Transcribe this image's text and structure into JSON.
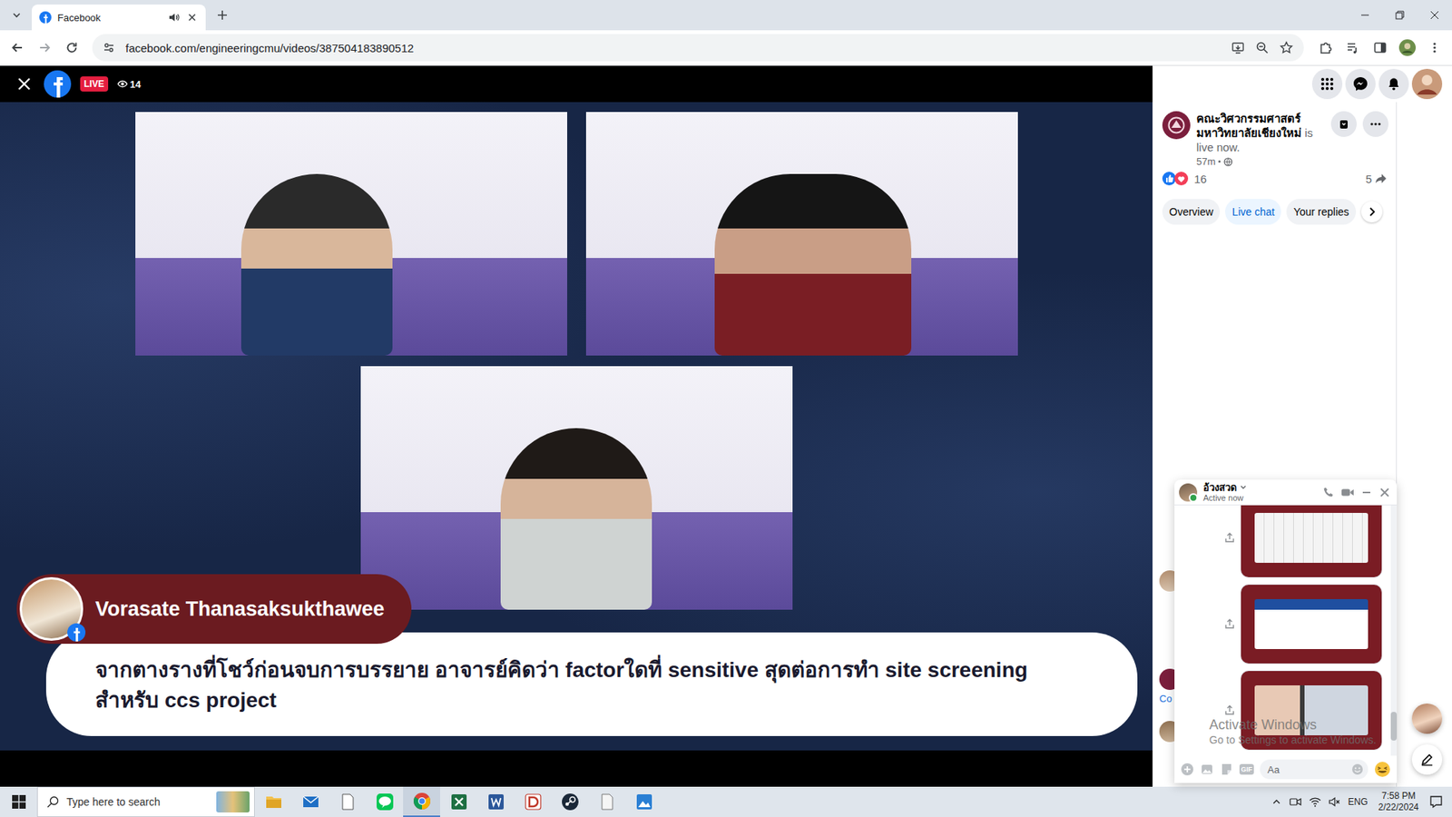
{
  "browser": {
    "tabs": [
      {
        "label": "Facebook",
        "selected": true,
        "audio_playing": true
      }
    ],
    "url": "facebook.com/engineeringcmu/videos/387504183890512"
  },
  "video": {
    "live_badge": "LIVE",
    "viewers": "14",
    "overlay": {
      "name": "Vorasate Thanasaksukthawee",
      "comment_lines": [
        "จากตางรางที่โชว์ก่อนจบการบรรยาย อาจารย์คิดว่า factorใดที่ sensitive สุดต่อการทำ site screening",
        "สำหรับ ccs project"
      ]
    }
  },
  "post": {
    "author": "คณะวิศวกรรมศาสตร์ มหาวิทยาลัยเชียงใหม่",
    "status": "is live now.",
    "time": "57m",
    "reactions": "16",
    "shares": "5"
  },
  "post_tabs": [
    {
      "label": "Overview",
      "selected": false
    },
    {
      "label": "Live chat",
      "selected": true
    },
    {
      "label": "Your replies",
      "selected": false
    }
  ],
  "live_chat": {
    "cut_text": "Co"
  },
  "messenger": {
    "name": "อ้วงสวด",
    "status": "Active now",
    "online": true,
    "attachments": [
      {
        "type": "image"
      },
      {
        "type": "image"
      },
      {
        "type": "image"
      }
    ],
    "gif_label": "GIF",
    "input_placeholder": "Aa"
  },
  "watermark": {
    "title": "Activate Windows",
    "subtitle": "Go to Settings to activate Windows."
  },
  "taskbar": {
    "search_placeholder": "Type here to search",
    "language": "ENG",
    "time": "7:58 PM",
    "date": "2/22/2024"
  }
}
